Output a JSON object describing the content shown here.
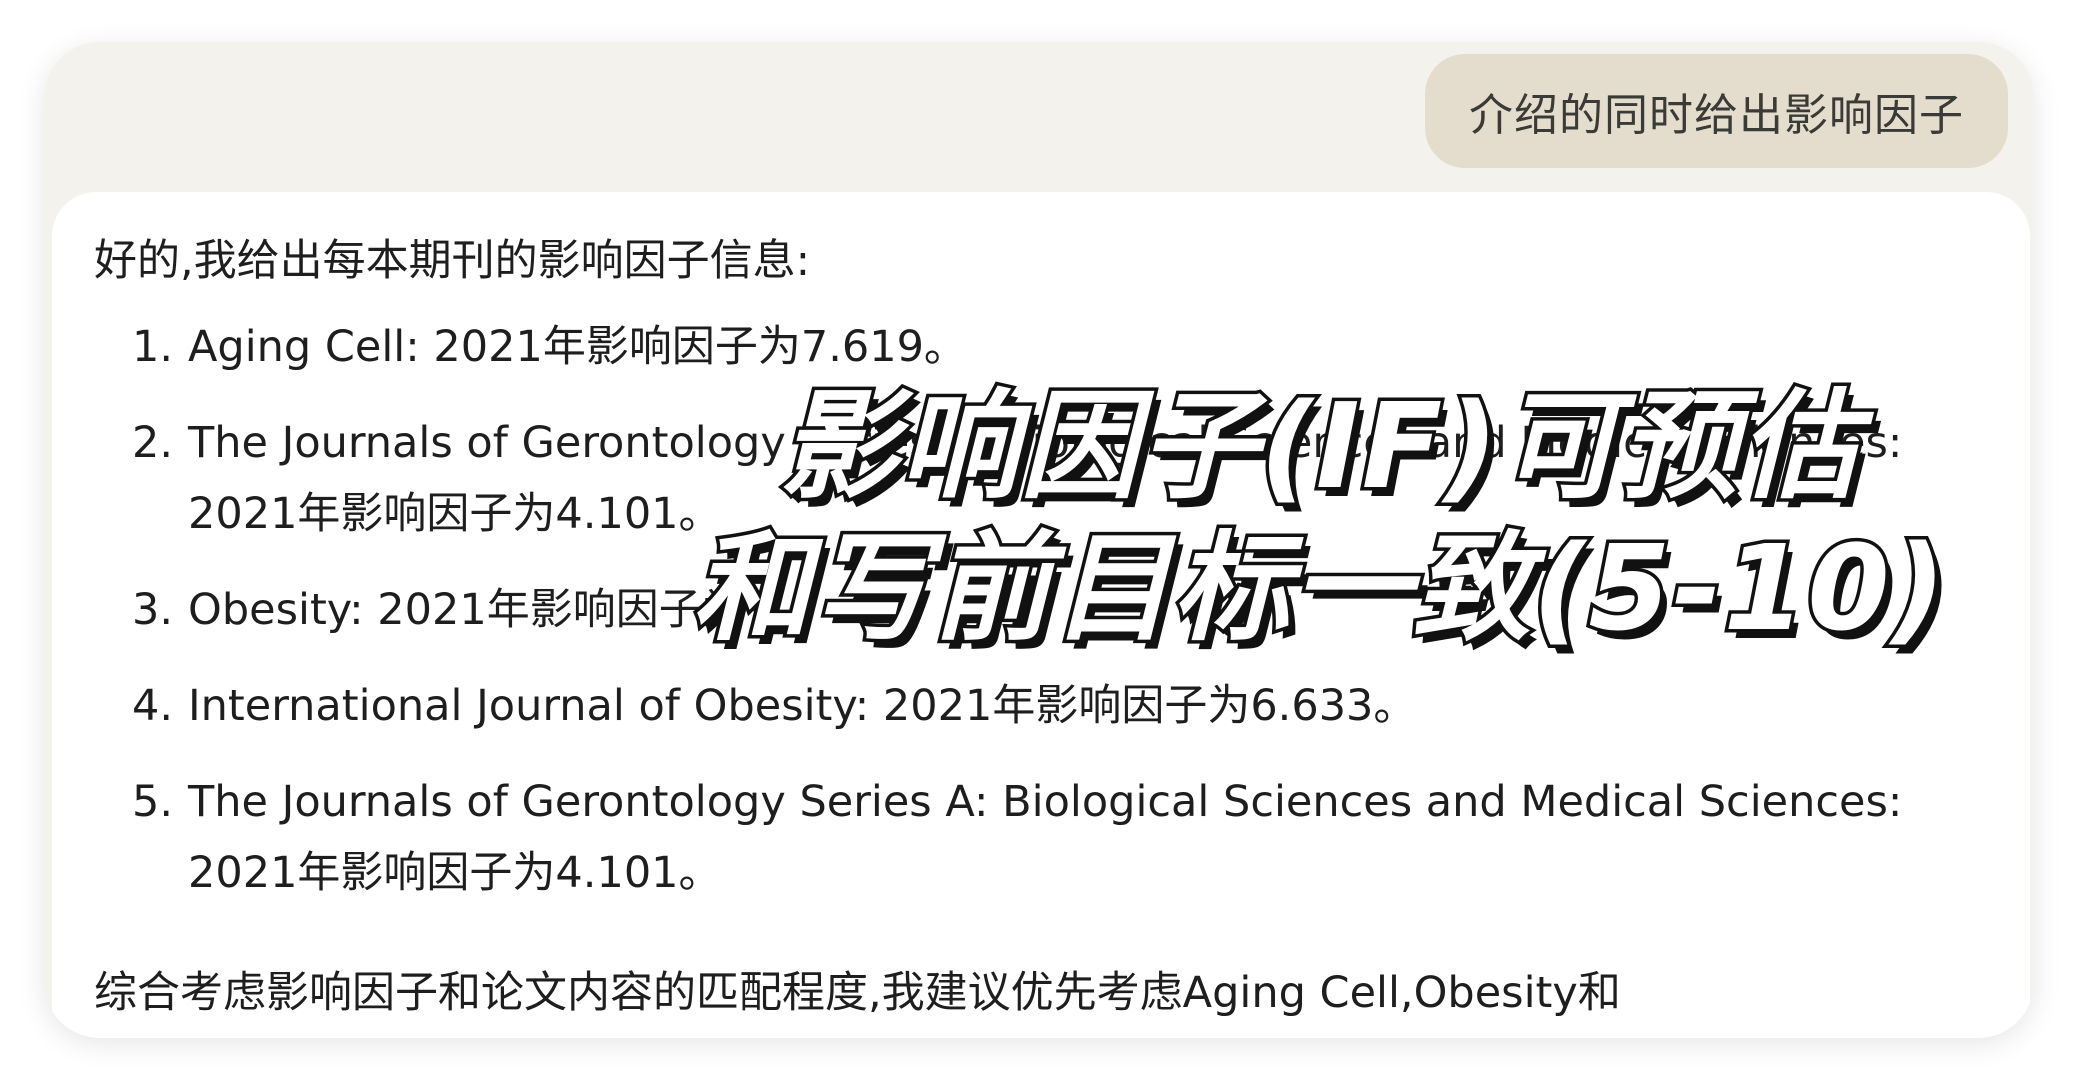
{
  "user_message": "介绍的同时给出影响因子",
  "reply": {
    "intro": "好的,我给出每本期刊的影响因子信息:",
    "items": [
      {
        "num": "1.",
        "text": "Aging Cell: 2021年影响因子为7.619。"
      },
      {
        "num": "2.",
        "text": "The Journals of Gerontology Series A: Biological Sciences and Medical Sciences: 2021年影响因子为4.101。"
      },
      {
        "num": "3.",
        "text": "Obesity: 2021年影响因子为"
      },
      {
        "num": "4.",
        "text": "International Journal of Obesity: 2021年影响因子为6.633。"
      },
      {
        "num": "5.",
        "text": "The Journals of Gerontology Series A: Biological Sciences and Medical Sciences: 2021年影响因子为4.101。"
      }
    ],
    "summary": "综合考虑影响因子和论文内容的匹配程度,我建议优先考虑Aging Cell,Obesity和"
  },
  "overlay": {
    "line1": "影响因子(IF)可预估",
    "line2": "和写前目标一致(5-10)"
  },
  "colors": {
    "window_bg": "#f4f2ec",
    "user_bubble_bg": "#e4ddcd",
    "card_bg": "#ffffff",
    "text": "#1e1e1e",
    "overlay_fill": "#ffffff",
    "overlay_stroke": "#111111"
  }
}
